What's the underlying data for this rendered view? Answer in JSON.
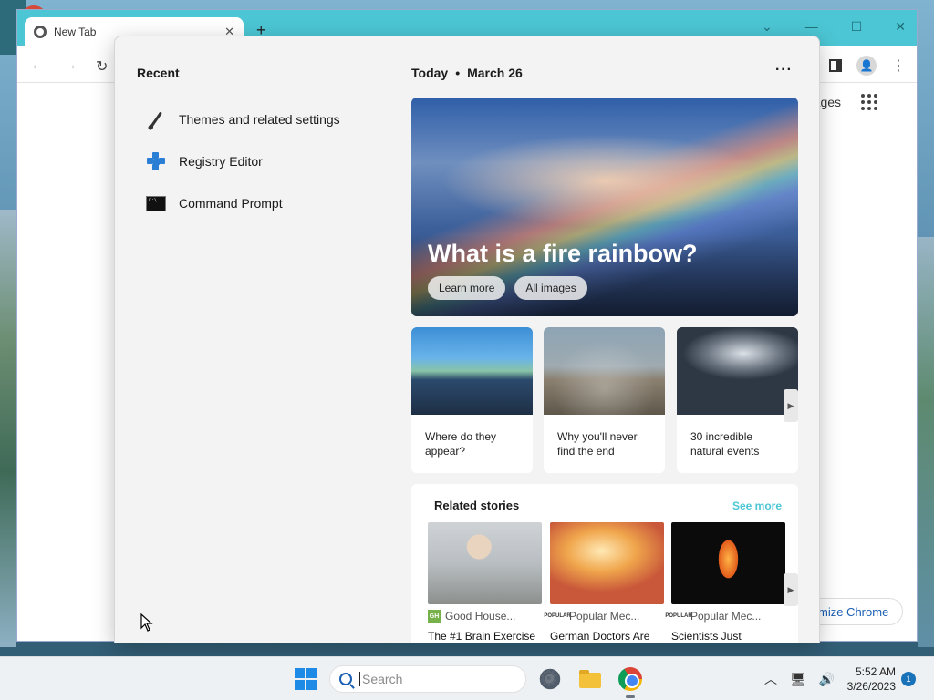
{
  "browser": {
    "tab_title": "New Tab",
    "tab_close": "✕",
    "new_tab": "+",
    "images_link": "mages",
    "customize_label": "mize Chrome"
  },
  "recent": {
    "title": "Recent",
    "items": [
      {
        "label": "Themes and related settings",
        "icon": "brush-icon"
      },
      {
        "label": "Registry Editor",
        "icon": "registry-icon"
      },
      {
        "label": "Command Prompt",
        "icon": "command-prompt-icon"
      }
    ]
  },
  "today": {
    "label": "Today",
    "separator": "•",
    "date": "March 26",
    "more": "···"
  },
  "hero": {
    "title": "What is a fire rainbow?",
    "learn_more": "Learn more",
    "all_images": "All images"
  },
  "cards": [
    {
      "caption": "Where do they appear?"
    },
    {
      "caption": "Why you'll never find the end"
    },
    {
      "caption": "30 incredible natural events"
    }
  ],
  "related": {
    "title": "Related stories",
    "see_more": "See more",
    "stories": [
      {
        "source_logo": "GH",
        "source": "Good House...",
        "headline": "The #1 Brain Exercise"
      },
      {
        "source_logo": "POPULAR",
        "source": "Popular Mec...",
        "headline": "German Doctors Are"
      },
      {
        "source_logo": "POPULAR",
        "source": "Popular Mec...",
        "headline": "Scientists Just"
      }
    ]
  },
  "taskbar": {
    "search_placeholder": "Search",
    "time": "5:52 AM",
    "date": "3/26/2023",
    "notification_count": "1"
  },
  "colors": {
    "accent": "#4cc6d4",
    "link": "#1a5fb4",
    "windows_blue": "#1d8ae6"
  }
}
